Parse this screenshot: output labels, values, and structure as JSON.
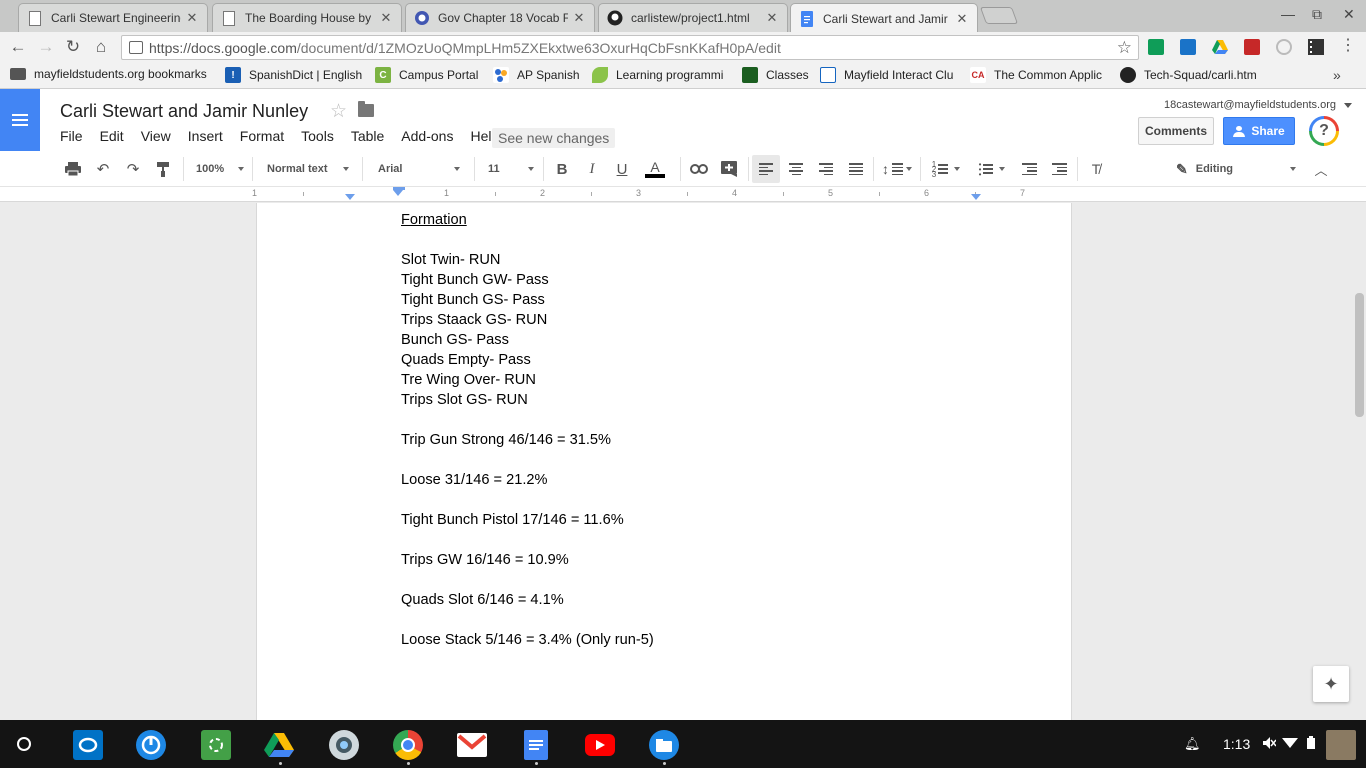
{
  "browser": {
    "tabs": [
      {
        "title": "Carli Stewart Engineering",
        "icon": "docs-page-icon"
      },
      {
        "title": "The Boarding House by",
        "icon": "docs-page-icon"
      },
      {
        "title": "Gov Chapter 18 Vocab F",
        "icon": "quizlet-icon"
      },
      {
        "title": "carlistew/project1.html",
        "icon": "github-icon"
      },
      {
        "title": "Carli Stewart and Jamir",
        "icon": "google-docs-icon"
      }
    ],
    "url_host": "https://docs.google.com",
    "url_path": "/document/d/1ZMOzUoQMmpLHm5ZXEkxtwe63OxurHqCbFsnKKafH0pA/edit",
    "bookmarks": [
      {
        "label": "mayfieldstudents.org bookmarks",
        "icon": "folder-icon"
      },
      {
        "label": "SpanishDict | English",
        "icon": "spanishdict-icon"
      },
      {
        "label": "Campus Portal",
        "icon": "campus-portal-icon"
      },
      {
        "label": "AP Spanish",
        "icon": "ap-spanish-icon"
      },
      {
        "label": "Learning programmi",
        "icon": "leaf-icon"
      },
      {
        "label": "Classes",
        "icon": "classroom-icon"
      },
      {
        "label": "Mayfield Interact Clu",
        "icon": "page-icon"
      },
      {
        "label": "The Common Applic",
        "icon": "common-app-icon"
      },
      {
        "label": "Tech-Squad/carli.htm",
        "icon": "github-icon"
      }
    ]
  },
  "docs": {
    "title": "Carli Stewart and Jamir Nunley",
    "menu": [
      "File",
      "Edit",
      "View",
      "Insert",
      "Format",
      "Tools",
      "Table",
      "Add-ons",
      "Help"
    ],
    "see_new_changes": "See new changes",
    "account": "18castewart@mayfieldstudents.org",
    "comments_label": "Comments",
    "share_label": "Share",
    "help_label": "?",
    "toolbar": {
      "zoom": "100%",
      "style": "Normal text",
      "font": "Arial",
      "size": "11",
      "bold": "B",
      "italic": "I",
      "underline": "U",
      "textcolor": "A",
      "mode": "Editing",
      "text_color_hex": "#000000"
    },
    "ruler_numbers": [
      "1",
      "1",
      "2",
      "3",
      "4",
      "5",
      "6",
      "7"
    ]
  },
  "document": {
    "heading": "Formation",
    "formations": [
      "Slot Twin- RUN",
      "Tight Bunch GW- Pass",
      "Tight Bunch GS- Pass",
      "Trips Staack GS- RUN",
      "Bunch GS- Pass",
      "Quads Empty- Pass",
      "Tre Wing Over- RUN",
      "Trips Slot GS- RUN"
    ],
    "stats": [
      "Trip Gun Strong 46/146 = 31.5%",
      "Loose 31/146 = 21.2%",
      "Tight Bunch Pistol 17/146 = 11.6%",
      "Trips GW 16/146 = 10.9%",
      "Quads Slot 6/146 = 4.1%",
      "Loose Stack 5/146 = 3.4% (Only run-5)"
    ]
  },
  "shelf": {
    "time": "1:13",
    "apps": [
      "outlook-icon",
      "power-icon",
      "sync-icon",
      "google-drive-icon",
      "webcam-icon",
      "chrome-icon",
      "gmail-icon",
      "google-docs-icon",
      "youtube-icon",
      "files-icon"
    ]
  },
  "colors": {
    "docs_blue": "#4285f4",
    "share_blue": "#4d90fe",
    "tab_strip": "#c7c8c7"
  }
}
